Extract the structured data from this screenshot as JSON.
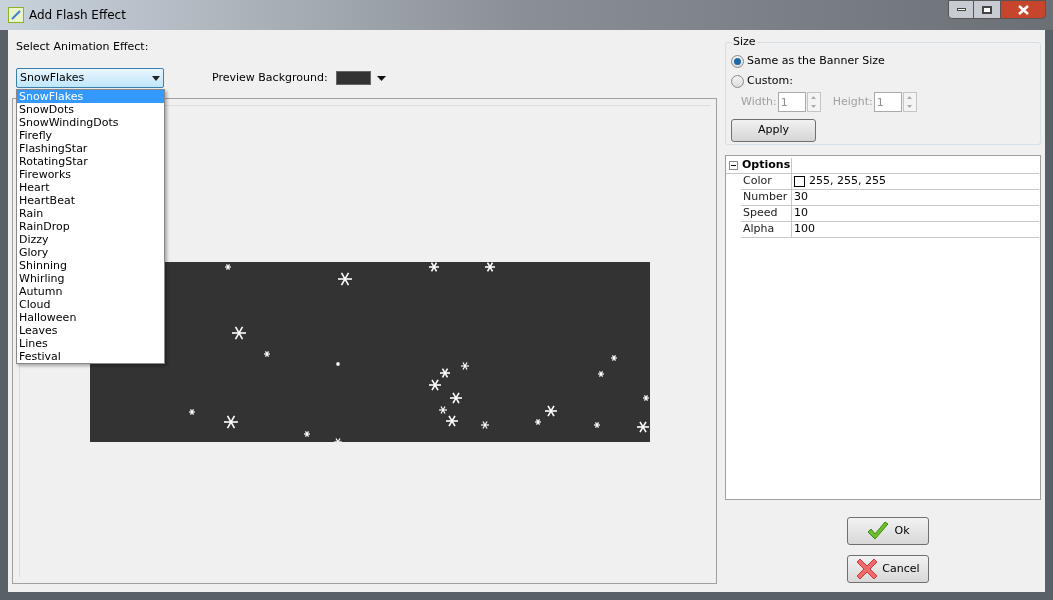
{
  "window": {
    "title": "Add Flash Effect"
  },
  "effect": {
    "label": "Select Animation Effect:",
    "value": "SnowFlakes",
    "expanded": true,
    "options": [
      {
        "label": "SnowFlakes",
        "selected": true
      },
      {
        "label": "SnowDots",
        "selected": false
      },
      {
        "label": "SnowWindingDots",
        "selected": false
      },
      {
        "label": "Firefly",
        "selected": false
      },
      {
        "label": "FlashingStar",
        "selected": false
      },
      {
        "label": "RotatingStar",
        "selected": false
      },
      {
        "label": "Fireworks",
        "selected": false
      },
      {
        "label": "Heart",
        "selected": false
      },
      {
        "label": "HeartBeat",
        "selected": false
      },
      {
        "label": "Rain",
        "selected": false
      },
      {
        "label": "RainDrop",
        "selected": false
      },
      {
        "label": "Dizzy",
        "selected": false
      },
      {
        "label": "Glory",
        "selected": false
      },
      {
        "label": "Shinning",
        "selected": false
      },
      {
        "label": "Whirling",
        "selected": false
      },
      {
        "label": "Autumn",
        "selected": false
      },
      {
        "label": "Cloud",
        "selected": false
      },
      {
        "label": "Halloween",
        "selected": false
      },
      {
        "label": "Leaves",
        "selected": false
      },
      {
        "label": "Lines",
        "selected": false
      },
      {
        "label": "Festival",
        "selected": false
      }
    ]
  },
  "preview_background": {
    "label": "Preview Background:"
  },
  "size": {
    "title": "Size",
    "options": [
      {
        "label": "Same as the Banner Size",
        "selected": true
      },
      {
        "label": "Custom:",
        "selected": false
      }
    ],
    "fields": [
      {
        "label": "Width:",
        "value": "1",
        "disabled": true
      },
      {
        "label": "Height:",
        "value": "1",
        "disabled": true
      }
    ],
    "apply": "Apply"
  },
  "options_grid": {
    "title": "Options",
    "expanded": true,
    "rows": [
      {
        "name": "Color",
        "value": "255, 255, 255",
        "kind": "color"
      },
      {
        "name": "Number",
        "value": "30",
        "kind": "text"
      },
      {
        "name": "Speed",
        "value": "10",
        "kind": "text"
      },
      {
        "name": "Alpha",
        "value": "100",
        "kind": "text"
      }
    ]
  },
  "buttons": [
    {
      "label": "Ok",
      "kind": "ok"
    },
    {
      "label": "Cancel",
      "kind": "cancel"
    }
  ]
}
